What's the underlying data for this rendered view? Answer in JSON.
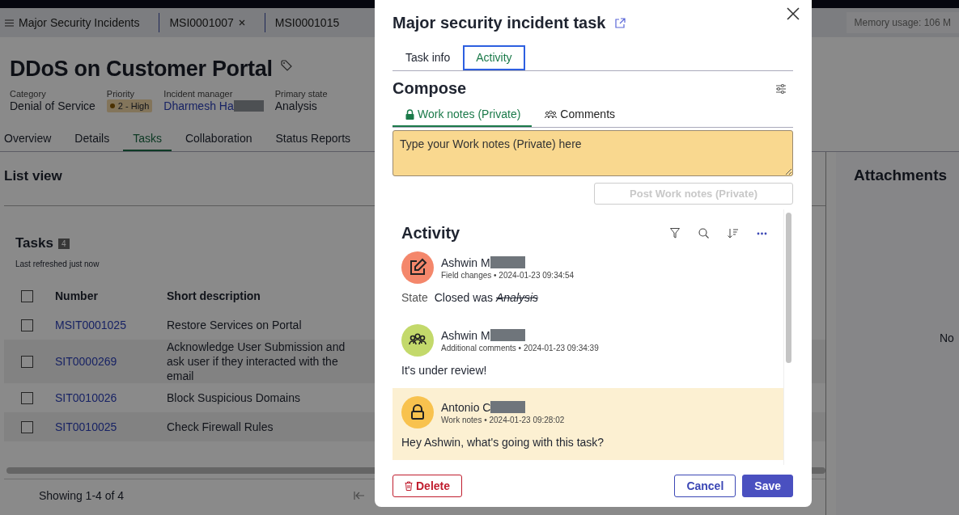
{
  "top_bar": {
    "memory_usage": "Memory usage: 106 M"
  },
  "tab_strip": [
    {
      "label": "Major Security Incidents",
      "kind": "list",
      "closable": false
    },
    {
      "label": "MSI0001007",
      "kind": "record",
      "closable": true
    },
    {
      "label": "MSI0001015",
      "kind": "record",
      "closable": false
    }
  ],
  "record": {
    "title": "DDoS on Customer Portal",
    "fields": [
      {
        "label": "Category",
        "value": "Denial of Service",
        "kind": "text"
      },
      {
        "label": "Priority",
        "value": "2 - High",
        "kind": "badge"
      },
      {
        "label": "Incident manager",
        "value": "Dharmesh Ha",
        "kind": "link",
        "redacted": true
      },
      {
        "label": "Primary state",
        "value": "Analysis",
        "kind": "text"
      }
    ]
  },
  "record_tabs": [
    {
      "label": "Overview",
      "selected": false
    },
    {
      "label": "Details",
      "selected": false
    },
    {
      "label": "Tasks",
      "selected": true
    },
    {
      "label": "Collaboration",
      "selected": false
    },
    {
      "label": "Status Reports",
      "selected": false
    }
  ],
  "list_view": {
    "title": "List view"
  },
  "tasks": {
    "title": "Tasks",
    "count": "4",
    "refreshed": "Last refreshed just now",
    "select_all_checked": false,
    "columns": [
      "Number",
      "Short description"
    ],
    "rows": [
      {
        "number": "MSIT0001025",
        "description": "Restore Services on Portal",
        "checked": false
      },
      {
        "number": "SIT0000269",
        "description": "Acknowledge User Submission and ask user if they interacted with the email",
        "checked": false
      },
      {
        "number": "SIT0010026",
        "description": "Block Suspicious Domains",
        "checked": false
      },
      {
        "number": "SIT0010025",
        "description": "Check Firewall Rules",
        "checked": false
      }
    ],
    "footer": "Showing 1-4 of 4"
  },
  "attachments": {
    "title": "Attachments",
    "empty_text": "No"
  },
  "modal": {
    "title": "Major security incident task",
    "tabs": [
      {
        "label": "Task info",
        "selected": false
      },
      {
        "label": "Activity",
        "selected": true
      }
    ],
    "compose": {
      "title": "Compose",
      "tabs": [
        {
          "label": "Work notes (Private)",
          "kind": "lock",
          "selected": true
        },
        {
          "label": "Comments",
          "kind": "people",
          "selected": false
        }
      ],
      "placeholder": "Type your Work notes (Private) here",
      "post_button": {
        "label": "Post Work notes (Private)",
        "disabled": true
      }
    },
    "activity": {
      "title": "Activity",
      "entries": [
        {
          "author": "Ashwin M",
          "redacted": true,
          "kind": "field_change",
          "type": "Field changes",
          "separator": "•",
          "time": "2024-01-23 09:34:54",
          "color": "#f4876b",
          "highlighted": false,
          "field": "State",
          "new_value": "Closed",
          "joiner": "was",
          "old_value": "Analysis"
        },
        {
          "author": "Ashwin M",
          "redacted": true,
          "kind": "comment",
          "type": "Additional comments",
          "separator": "•",
          "time": "2024-01-23 09:34:39",
          "color": "#c3d96b",
          "highlighted": false,
          "text": "It's under review!"
        },
        {
          "author": "Antonio C",
          "redacted": true,
          "kind": "work_note",
          "type": "Work notes",
          "separator": "•",
          "time": "2024-01-23 09:28:02",
          "color": "#f8c24e",
          "highlighted": true,
          "text": "Hey Ashwin, what's going with this task?"
        }
      ]
    },
    "buttons": [
      {
        "label": "Delete",
        "kind": "danger"
      },
      {
        "label": "Cancel",
        "kind": "secondary"
      },
      {
        "label": "Save",
        "kind": "primary"
      }
    ]
  }
}
